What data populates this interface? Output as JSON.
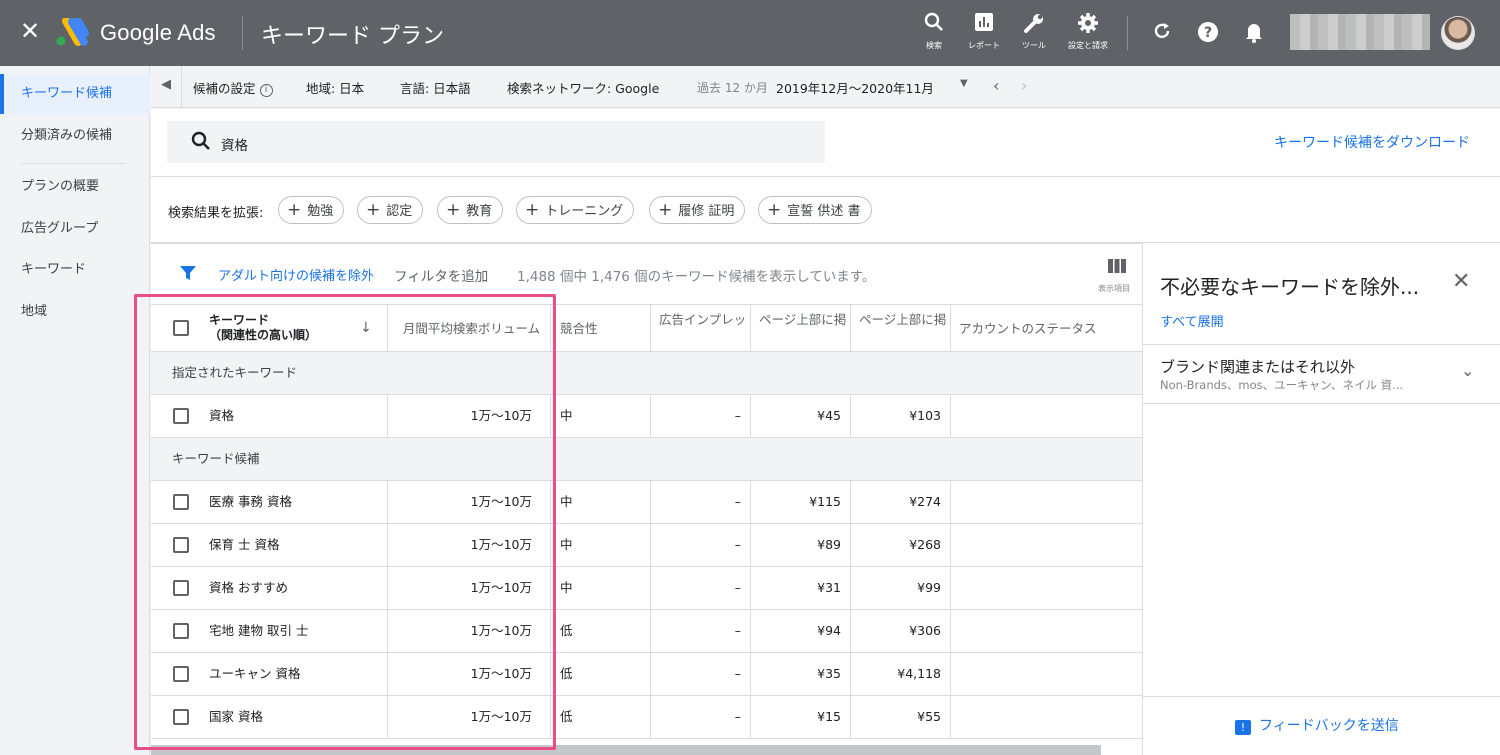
{
  "topbar": {
    "close_icon": "close-icon",
    "brand": "Google Ads",
    "title": "キーワード プラン",
    "tools": [
      {
        "icon": "search-icon",
        "label": "検索"
      },
      {
        "icon": "report-icon",
        "label": "レポート"
      },
      {
        "icon": "wrench-icon",
        "label": "ツール"
      },
      {
        "icon": "gear-icon",
        "label": "設定と請求"
      }
    ],
    "right_icons": [
      "refresh-icon",
      "help-icon",
      "bell-icon"
    ]
  },
  "sidebar": {
    "items": [
      {
        "label": "キーワード候補",
        "active": true
      },
      {
        "label": "分類済みの候補",
        "active": false
      },
      {
        "label": "プランの概要",
        "active": false
      },
      {
        "label": "広告グループ",
        "active": false
      },
      {
        "label": "キーワード",
        "active": false
      },
      {
        "label": "地域",
        "active": false
      }
    ]
  },
  "settings": {
    "label": "候補の設定",
    "region": "地域: 日本",
    "language": "言語: 日本語",
    "network": "検索ネットワーク: Google",
    "period_label": "過去 12 か月",
    "period_value": "2019年12月～2020年11月"
  },
  "search": {
    "value": "資格",
    "download_link": "キーワード候補をダウンロード"
  },
  "expand": {
    "label": "検索結果を拡張:",
    "chips": [
      "勉強",
      "認定",
      "教育",
      "トレーニング",
      "履修 証明",
      "宣誓 供述 書"
    ]
  },
  "filter": {
    "adult_exclude": "アダルト向けの候補を除外",
    "add_filter": "フィルタを追加",
    "count_text": "1,488 個中 1,476 個のキーワード候補を表示しています。",
    "columns_label": "表示項目"
  },
  "table": {
    "headers": {
      "keyword_line1": "キーワード",
      "keyword_line2": "（関連性の高い順）",
      "volume": "月間平均検索ボリューム",
      "competition": "競合性",
      "impression": "広告インプレッ",
      "bid_low": "ページ上部に掲",
      "bid_high": "ページ上部に掲",
      "account_status": "アカウントのステータス"
    },
    "group_specified": "指定されたキーワード",
    "group_ideas": "キーワード候補",
    "specified_rows": [
      {
        "keyword": "資格",
        "volume": "1万～10万",
        "competition": "中",
        "impression": "–",
        "bid_low": "¥45",
        "bid_high": "¥103"
      }
    ],
    "idea_rows": [
      {
        "keyword": "医療 事務 資格",
        "volume": "1万～10万",
        "competition": "中",
        "impression": "–",
        "bid_low": "¥115",
        "bid_high": "¥274"
      },
      {
        "keyword": "保育 士 資格",
        "volume": "1万～10万",
        "competition": "中",
        "impression": "–",
        "bid_low": "¥89",
        "bid_high": "¥268"
      },
      {
        "keyword": "資格 おすすめ",
        "volume": "1万～10万",
        "competition": "中",
        "impression": "–",
        "bid_low": "¥31",
        "bid_high": "¥99"
      },
      {
        "keyword": "宅地 建物 取引 士",
        "volume": "1万～10万",
        "competition": "低",
        "impression": "–",
        "bid_low": "¥94",
        "bid_high": "¥306"
      },
      {
        "keyword": "ユーキャン 資格",
        "volume": "1万～10万",
        "competition": "低",
        "impression": "–",
        "bid_low": "¥35",
        "bid_high": "¥4,118"
      },
      {
        "keyword": "国家 資格",
        "volume": "1万～10万",
        "competition": "低",
        "impression": "–",
        "bid_low": "¥15",
        "bid_high": "¥55"
      }
    ]
  },
  "panel": {
    "title": "不必要なキーワードを除外...",
    "expand_all": "すべて展開",
    "group_title": "ブランド関連またはそれ以外",
    "group_sub": "Non-Brands、mos、ユーキャン、ネイル 資...",
    "feedback": "フィードバックを送信"
  },
  "colors": {
    "topbar": "#5f6368",
    "accent": "#1a73e8",
    "highlight": "#ea4c89"
  }
}
